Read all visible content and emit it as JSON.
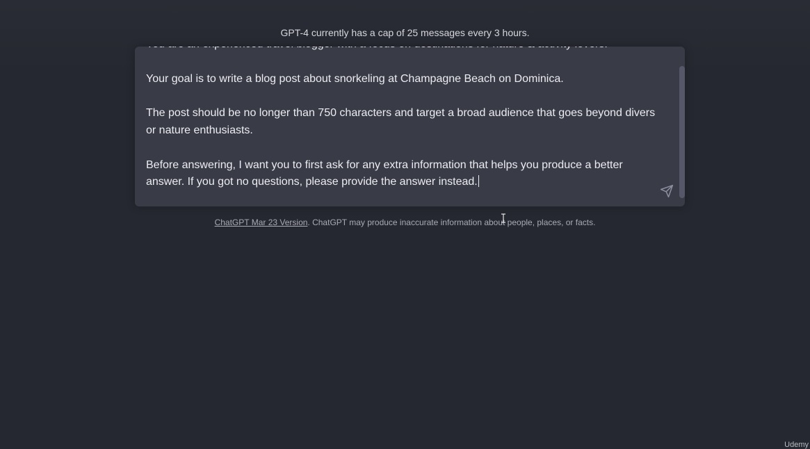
{
  "header": {
    "cap_notice": "GPT-4 currently has a cap of 25 messages every 3 hours."
  },
  "composer": {
    "paragraphs": [
      "You are an experienced travel blogger with a focus on destinations for nature & activity lovers.",
      "Your goal is to write a blog post about snorkeling at Champagne Beach on Dominica.",
      "The post should be no longer than 750 characters and target a broad audience that goes beyond divers or nature enthusiasts.",
      "Before answering, I want you to first ask for any extra information that helps you produce a better answer. If you got no questions, please provide the answer instead."
    ],
    "send_icon": "paper-plane-icon"
  },
  "footer": {
    "version_link": "ChatGPT Mar 23 Version",
    "disclaimer": ". ChatGPT may produce inaccurate information about people, places, or facts."
  },
  "watermark": "Udemy",
  "colors": {
    "background": "#262831",
    "composer_bg": "#393b47",
    "text": "#ececf1",
    "muted": "#a9aab3"
  }
}
